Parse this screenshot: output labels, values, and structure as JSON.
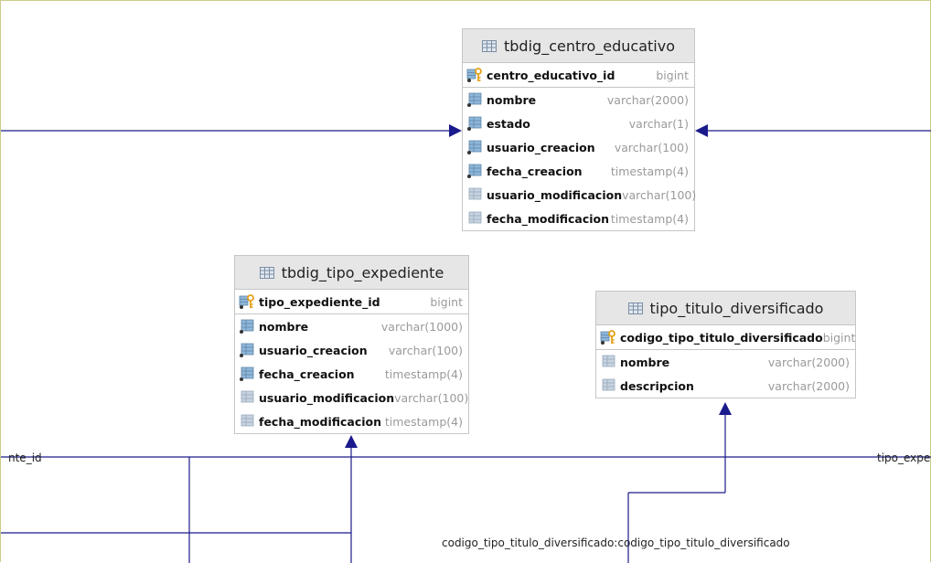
{
  "colors": {
    "line": "#1a1a8c",
    "header_bg": "#e6e6e6",
    "border": "#c6c6c6",
    "type_text": "#9a9a9a"
  },
  "tables": {
    "centro": {
      "title": "tbdig_centro_educativo",
      "columns": [
        {
          "name": "centro_educativo_id",
          "type": "bigint",
          "icon": "primary-key-icon"
        },
        {
          "name": "nombre",
          "type": "varchar(2000)",
          "icon": "column-icon"
        },
        {
          "name": "estado",
          "type": "varchar(1)",
          "icon": "column-icon"
        },
        {
          "name": "usuario_creacion",
          "type": "varchar(100)",
          "icon": "column-icon"
        },
        {
          "name": "fecha_creacion",
          "type": "timestamp(4)",
          "icon": "column-icon"
        },
        {
          "name": "usuario_modificacion",
          "type": "varchar(100)",
          "icon": "nullable-column-icon"
        },
        {
          "name": "fecha_modificacion",
          "type": "timestamp(4)",
          "icon": "nullable-column-icon"
        }
      ]
    },
    "tipo_exp": {
      "title": "tbdig_tipo_expediente",
      "columns": [
        {
          "name": "tipo_expediente_id",
          "type": "bigint",
          "icon": "primary-key-icon"
        },
        {
          "name": "nombre",
          "type": "varchar(1000)",
          "icon": "column-icon"
        },
        {
          "name": "usuario_creacion",
          "type": "varchar(100)",
          "icon": "column-icon"
        },
        {
          "name": "fecha_creacion",
          "type": "timestamp(4)",
          "icon": "column-icon"
        },
        {
          "name": "usuario_modificacion",
          "type": "varchar(100)",
          "icon": "nullable-column-icon"
        },
        {
          "name": "fecha_modificacion",
          "type": "timestamp(4)",
          "icon": "nullable-column-icon"
        }
      ]
    },
    "titulo": {
      "title": "tipo_titulo_diversificado",
      "columns": [
        {
          "name": "codigo_tipo_titulo_diversificado",
          "type": "bigint",
          "icon": "primary-key-icon"
        },
        {
          "name": "nombre",
          "type": "varchar(2000)",
          "icon": "nullable-column-icon"
        },
        {
          "name": "descripcion",
          "type": "varchar(2000)",
          "icon": "nullable-column-icon"
        }
      ]
    }
  },
  "relation_labels": {
    "left": "nte_id",
    "right": "tipo_expe",
    "bottom": "codigo_tipo_titulo_diversificado:codigo_tipo_titulo_diversificado"
  }
}
